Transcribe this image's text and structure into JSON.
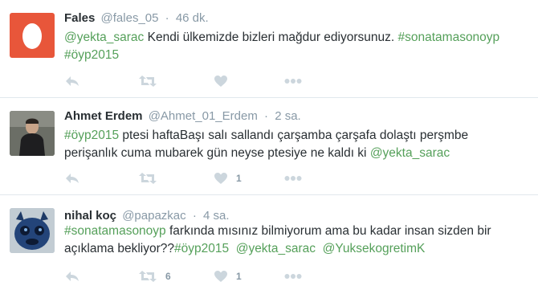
{
  "tweets": [
    {
      "name": "Fales",
      "handle": "@fales_05",
      "sep": "·",
      "time": "46 dk.",
      "avatar": "egg-avatar",
      "text": [
        {
          "t": "@yekta_sarac",
          "link": true
        },
        {
          "t": " Kendi ülkemizde bizleri mağdur ediyorsunuz. ",
          "link": false
        },
        {
          "t": "#sonatamasonoyp",
          "link": true
        },
        {
          "t": " ",
          "link": false
        },
        {
          "t": "#öyp2015",
          "link": true
        }
      ],
      "retweet_count": "",
      "like_count": ""
    },
    {
      "name": "Ahmet Erdem",
      "handle": "@Ahmet_01_Erdem",
      "sep": "·",
      "time": "2 sa.",
      "avatar": "photo-avatar",
      "text": [
        {
          "t": "#öyp2015",
          "link": true
        },
        {
          "t": " ptesi haftaBaşı salı sallandı çarşamba çarşafa dolaştı perşmbe perişanlık cuma mubarek gün neyse ptesiye ne kaldı ki ",
          "link": false
        },
        {
          "t": "@yekta_sarac",
          "link": true
        }
      ],
      "retweet_count": "",
      "like_count": "1"
    },
    {
      "name": "nihal koç",
      "handle": "@papazkac",
      "sep": "·",
      "time": "4 sa.",
      "avatar": "monster-avatar",
      "text": [
        {
          "t": "#sonatamasonoyp",
          "link": true
        },
        {
          "t": " farkında  mısınız  bilmiyorum ama bu kadar insan sizden bir açıklama  bekliyor??",
          "link": false
        },
        {
          "t": "#öyp2015",
          "link": true
        },
        {
          "t": "  ",
          "link": false
        },
        {
          "t": "@yekta_sarac",
          "link": true
        },
        {
          "t": "  ",
          "link": false
        },
        {
          "t": "@YuksekogretimK",
          "link": true
        }
      ],
      "retweet_count": "6",
      "like_count": "1"
    }
  ],
  "colors": {
    "link": "#55a05a",
    "meta": "#8899a6",
    "icon": "#ccd6dd",
    "egg_bg": "#e8563a"
  },
  "icons": [
    "reply-icon",
    "retweet-icon",
    "like-icon",
    "more-icon"
  ]
}
